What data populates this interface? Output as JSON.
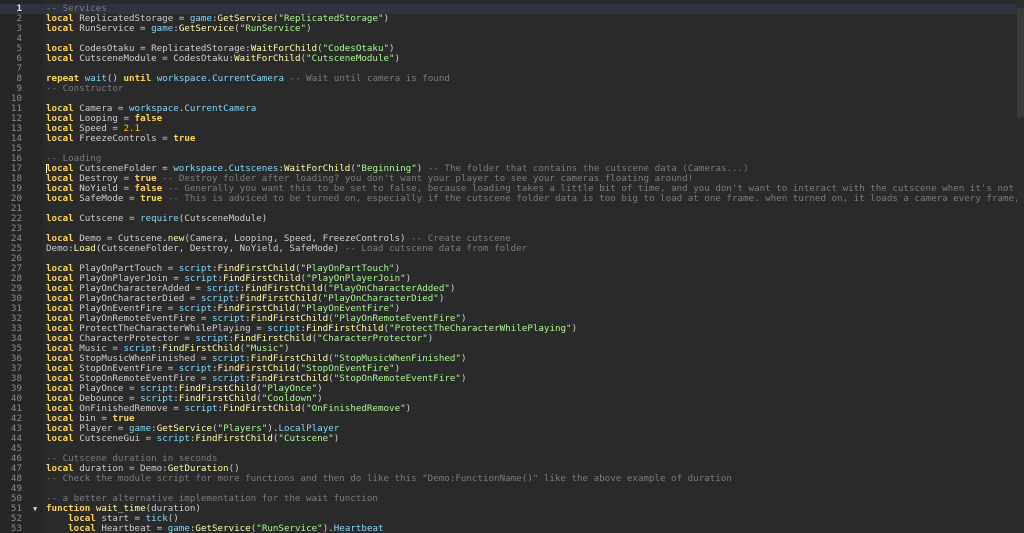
{
  "lines": [
    {
      "n": "1",
      "t": [
        [
          "cm",
          "-- Services"
        ]
      ]
    },
    {
      "n": "2",
      "t": [
        [
          "kw",
          "local"
        ],
        [
          "p",
          " ReplicatedStorage = "
        ],
        [
          "bi",
          "game"
        ],
        [
          "p",
          ":"
        ],
        [
          "fn",
          "GetService"
        ],
        [
          "p",
          "("
        ],
        [
          "str",
          "\"ReplicatedStorage\""
        ],
        [
          "p",
          ")"
        ]
      ]
    },
    {
      "n": "3",
      "t": [
        [
          "kw",
          "local"
        ],
        [
          "p",
          " RunService = "
        ],
        [
          "bi",
          "game"
        ],
        [
          "p",
          ":"
        ],
        [
          "fn",
          "GetService"
        ],
        [
          "p",
          "("
        ],
        [
          "str",
          "\"RunService\""
        ],
        [
          "p",
          ")"
        ]
      ]
    },
    {
      "n": "4",
      "t": []
    },
    {
      "n": "5",
      "t": [
        [
          "kw",
          "local"
        ],
        [
          "p",
          " CodesOtaku = ReplicatedStorage:"
        ],
        [
          "fn",
          "WaitForChild"
        ],
        [
          "p",
          "("
        ],
        [
          "str",
          "\"CodesOtaku\""
        ],
        [
          "p",
          ")"
        ]
      ]
    },
    {
      "n": "6",
      "t": [
        [
          "kw",
          "local"
        ],
        [
          "p",
          " CutsceneModule = CodesOtaku:"
        ],
        [
          "fn",
          "WaitForChild"
        ],
        [
          "p",
          "("
        ],
        [
          "str",
          "\"CutsceneModule\""
        ],
        [
          "p",
          ")"
        ]
      ]
    },
    {
      "n": "7",
      "t": []
    },
    {
      "n": "8",
      "t": [
        [
          "kw",
          "repeat"
        ],
        [
          "p",
          " "
        ],
        [
          "bi",
          "wait"
        ],
        [
          "p",
          "() "
        ],
        [
          "kw",
          "until"
        ],
        [
          "p",
          " "
        ],
        [
          "bi",
          "workspace"
        ],
        [
          "p",
          "."
        ],
        [
          "bi",
          "CurrentCamera"
        ],
        [
          "p",
          " "
        ],
        [
          "cm",
          "-- Wait until camera is found"
        ]
      ]
    },
    {
      "n": "9",
      "t": [
        [
          "cm",
          "-- Constructor"
        ]
      ]
    },
    {
      "n": "10",
      "t": []
    },
    {
      "n": "11",
      "t": [
        [
          "kw",
          "local"
        ],
        [
          "p",
          " Camera = "
        ],
        [
          "bi",
          "workspace"
        ],
        [
          "p",
          "."
        ],
        [
          "bi",
          "CurrentCamera"
        ]
      ]
    },
    {
      "n": "12",
      "t": [
        [
          "kw",
          "local"
        ],
        [
          "p",
          " Looping = "
        ],
        [
          "kw",
          "false"
        ]
      ]
    },
    {
      "n": "13",
      "t": [
        [
          "kw",
          "local"
        ],
        [
          "p",
          " Speed = "
        ],
        [
          "num",
          "2.1"
        ]
      ]
    },
    {
      "n": "14",
      "t": [
        [
          "kw",
          "local"
        ],
        [
          "p",
          " FreezeControls = "
        ],
        [
          "kw",
          "true"
        ]
      ]
    },
    {
      "n": "15",
      "t": []
    },
    {
      "n": "16",
      "t": [
        [
          "cm",
          "-- Loading"
        ]
      ]
    },
    {
      "n": "17",
      "t": [
        [
          "kw",
          "local"
        ],
        [
          "p",
          " CutsceneFolder = "
        ],
        [
          "bi",
          "workspace"
        ],
        [
          "p",
          "."
        ],
        [
          "bi",
          "Cutscenes"
        ],
        [
          "p",
          ":"
        ],
        [
          "fn",
          "WaitForChild"
        ],
        [
          "p",
          "("
        ],
        [
          "str",
          "\"Beginning\""
        ],
        [
          "p",
          ") "
        ],
        [
          "cm",
          "-- The folder that contains the cutscene data (Cameras...)"
        ]
      ]
    },
    {
      "n": "18",
      "t": [
        [
          "kw",
          "local"
        ],
        [
          "p",
          " Destroy = "
        ],
        [
          "kw",
          "true"
        ],
        [
          "p",
          " "
        ],
        [
          "cm",
          "-- Destroy folder after loading? you don't want your player to see your cameras floating around!"
        ]
      ]
    },
    {
      "n": "19",
      "t": [
        [
          "kw",
          "local"
        ],
        [
          "p",
          " NoYield = "
        ],
        [
          "kw",
          "false"
        ],
        [
          "p",
          " "
        ],
        [
          "cm",
          "-- Generally you want this to be set to false, because loading takes a little bit of time, and you don't want to interact with the cutscene when it's not loade"
        ]
      ]
    },
    {
      "n": "20",
      "t": [
        [
          "kw",
          "local"
        ],
        [
          "p",
          " SafeMode = "
        ],
        [
          "kw",
          "true"
        ],
        [
          "p",
          " "
        ],
        [
          "cm",
          "-- This is adviced to be turned on, especially if the cutscene folder data is too big to load at one frame. when turned on, it loads a camera every frame, not"
        ]
      ]
    },
    {
      "n": "21",
      "t": []
    },
    {
      "n": "22",
      "t": [
        [
          "kw",
          "local"
        ],
        [
          "p",
          " Cutscene = "
        ],
        [
          "bi",
          "require"
        ],
        [
          "p",
          "(CutsceneModule)"
        ]
      ]
    },
    {
      "n": "23",
      "t": []
    },
    {
      "n": "24",
      "t": [
        [
          "kw",
          "local"
        ],
        [
          "p",
          " Demo = Cutscene."
        ],
        [
          "fn",
          "new"
        ],
        [
          "p",
          "(Camera, Looping, Speed, FreezeControls) "
        ],
        [
          "cm",
          "-- Create cutscene"
        ]
      ]
    },
    {
      "n": "25",
      "t": [
        [
          "p",
          "Demo:"
        ],
        [
          "fn",
          "Load"
        ],
        [
          "p",
          "(CutsceneFolder, Destroy, NoYield, SafeMode) "
        ],
        [
          "cm",
          "-- Load cutscene data from folder"
        ]
      ]
    },
    {
      "n": "26",
      "t": []
    },
    {
      "n": "27",
      "t": [
        [
          "kw",
          "local"
        ],
        [
          "p",
          " PlayOnPartTouch = "
        ],
        [
          "bi",
          "script"
        ],
        [
          "p",
          ":"
        ],
        [
          "fn",
          "FindFirstChild"
        ],
        [
          "p",
          "("
        ],
        [
          "str",
          "\"PlayOnPartTouch\""
        ],
        [
          "p",
          ")"
        ]
      ]
    },
    {
      "n": "28",
      "t": [
        [
          "kw",
          "local"
        ],
        [
          "p",
          " PlayOnPlayerJoin = "
        ],
        [
          "bi",
          "script"
        ],
        [
          "p",
          ":"
        ],
        [
          "fn",
          "FindFirstChild"
        ],
        [
          "p",
          "("
        ],
        [
          "str",
          "\"PlayOnPlayerJoin\""
        ],
        [
          "p",
          ")"
        ]
      ]
    },
    {
      "n": "29",
      "t": [
        [
          "kw",
          "local"
        ],
        [
          "p",
          " PlayOnCharacterAdded = "
        ],
        [
          "bi",
          "script"
        ],
        [
          "p",
          ":"
        ],
        [
          "fn",
          "FindFirstChild"
        ],
        [
          "p",
          "("
        ],
        [
          "str",
          "\"PlayOnCharacterAdded\""
        ],
        [
          "p",
          ")"
        ]
      ]
    },
    {
      "n": "30",
      "t": [
        [
          "kw",
          "local"
        ],
        [
          "p",
          " PlayOnCharacterDied = "
        ],
        [
          "bi",
          "script"
        ],
        [
          "p",
          ":"
        ],
        [
          "fn",
          "FindFirstChild"
        ],
        [
          "p",
          "("
        ],
        [
          "str",
          "\"PlayOnCharacterDied\""
        ],
        [
          "p",
          ")"
        ]
      ]
    },
    {
      "n": "31",
      "t": [
        [
          "kw",
          "local"
        ],
        [
          "p",
          " PlayOnEventFire = "
        ],
        [
          "bi",
          "script"
        ],
        [
          "p",
          ":"
        ],
        [
          "fn",
          "FindFirstChild"
        ],
        [
          "p",
          "("
        ],
        [
          "str",
          "\"PlayOnEventFire\""
        ],
        [
          "p",
          ")"
        ]
      ]
    },
    {
      "n": "32",
      "t": [
        [
          "kw",
          "local"
        ],
        [
          "p",
          " PlayOnRemoteEventFire = "
        ],
        [
          "bi",
          "script"
        ],
        [
          "p",
          ":"
        ],
        [
          "fn",
          "FindFirstChild"
        ],
        [
          "p",
          "("
        ],
        [
          "str",
          "\"PlayOnRemoteEventFire\""
        ],
        [
          "p",
          ")"
        ]
      ]
    },
    {
      "n": "33",
      "t": [
        [
          "kw",
          "local"
        ],
        [
          "p",
          " ProtectTheCharacterWhilePlaying = "
        ],
        [
          "bi",
          "script"
        ],
        [
          "p",
          ":"
        ],
        [
          "fn",
          "FindFirstChild"
        ],
        [
          "p",
          "("
        ],
        [
          "str",
          "\"ProtectTheCharacterWhilePlaying\""
        ],
        [
          "p",
          ")"
        ]
      ]
    },
    {
      "n": "34",
      "t": [
        [
          "kw",
          "local"
        ],
        [
          "p",
          " CharacterProtector = "
        ],
        [
          "bi",
          "script"
        ],
        [
          "p",
          ":"
        ],
        [
          "fn",
          "FindFirstChild"
        ],
        [
          "p",
          "("
        ],
        [
          "str",
          "\"CharacterProtector\""
        ],
        [
          "p",
          ")"
        ]
      ]
    },
    {
      "n": "35",
      "t": [
        [
          "kw",
          "local"
        ],
        [
          "p",
          " Music = "
        ],
        [
          "bi",
          "script"
        ],
        [
          "p",
          ":"
        ],
        [
          "fn",
          "FindFirstChild"
        ],
        [
          "p",
          "("
        ],
        [
          "str",
          "\"Music\""
        ],
        [
          "p",
          ")"
        ]
      ]
    },
    {
      "n": "36",
      "t": [
        [
          "kw",
          "local"
        ],
        [
          "p",
          " StopMusicWhenFinished = "
        ],
        [
          "bi",
          "script"
        ],
        [
          "p",
          ":"
        ],
        [
          "fn",
          "FindFirstChild"
        ],
        [
          "p",
          "("
        ],
        [
          "str",
          "\"StopMusicWhenFinished\""
        ],
        [
          "p",
          ")"
        ]
      ]
    },
    {
      "n": "37",
      "t": [
        [
          "kw",
          "local"
        ],
        [
          "p",
          " StopOnEventFire = "
        ],
        [
          "bi",
          "script"
        ],
        [
          "p",
          ":"
        ],
        [
          "fn",
          "FindFirstChild"
        ],
        [
          "p",
          "("
        ],
        [
          "str",
          "\"StopOnEventFire\""
        ],
        [
          "p",
          ")"
        ]
      ]
    },
    {
      "n": "38",
      "t": [
        [
          "kw",
          "local"
        ],
        [
          "p",
          " StopOnRemoteEventFire = "
        ],
        [
          "bi",
          "script"
        ],
        [
          "p",
          ":"
        ],
        [
          "fn",
          "FindFirstChild"
        ],
        [
          "p",
          "("
        ],
        [
          "str",
          "\"StopOnRemoteEventFire\""
        ],
        [
          "p",
          ")"
        ]
      ]
    },
    {
      "n": "39",
      "t": [
        [
          "kw",
          "local"
        ],
        [
          "p",
          " PlayOnce = "
        ],
        [
          "bi",
          "script"
        ],
        [
          "p",
          ":"
        ],
        [
          "fn",
          "FindFirstChild"
        ],
        [
          "p",
          "("
        ],
        [
          "str",
          "\"PlayOnce\""
        ],
        [
          "p",
          ")"
        ]
      ]
    },
    {
      "n": "40",
      "t": [
        [
          "kw",
          "local"
        ],
        [
          "p",
          " Debounce = "
        ],
        [
          "bi",
          "script"
        ],
        [
          "p",
          ":"
        ],
        [
          "fn",
          "FindFirstChild"
        ],
        [
          "p",
          "("
        ],
        [
          "str",
          "\"Cooldown\""
        ],
        [
          "p",
          ")"
        ]
      ]
    },
    {
      "n": "41",
      "t": [
        [
          "kw",
          "local"
        ],
        [
          "p",
          " OnFinishedRemove = "
        ],
        [
          "bi",
          "script"
        ],
        [
          "p",
          ":"
        ],
        [
          "fn",
          "FindFirstChild"
        ],
        [
          "p",
          "("
        ],
        [
          "str",
          "\"OnFinishedRemove\""
        ],
        [
          "p",
          ")"
        ]
      ]
    },
    {
      "n": "42",
      "t": [
        [
          "kw",
          "local"
        ],
        [
          "p",
          " bin = "
        ],
        [
          "kw",
          "true"
        ]
      ]
    },
    {
      "n": "43",
      "t": [
        [
          "kw",
          "local"
        ],
        [
          "p",
          " Player = "
        ],
        [
          "bi",
          "game"
        ],
        [
          "p",
          ":"
        ],
        [
          "fn",
          "GetService"
        ],
        [
          "p",
          "("
        ],
        [
          "str",
          "\"Players\""
        ],
        [
          "p",
          ")."
        ],
        [
          "bi",
          "LocalPlayer"
        ]
      ]
    },
    {
      "n": "44",
      "t": [
        [
          "kw",
          "local"
        ],
        [
          "p",
          " CutsceneGui = "
        ],
        [
          "bi",
          "script"
        ],
        [
          "p",
          ":"
        ],
        [
          "fn",
          "FindFirstChild"
        ],
        [
          "p",
          "("
        ],
        [
          "str",
          "\"Cutscene\""
        ],
        [
          "p",
          ")"
        ]
      ]
    },
    {
      "n": "45",
      "t": []
    },
    {
      "n": "46",
      "t": [
        [
          "cm",
          "-- Cutscene duration in seconds"
        ]
      ]
    },
    {
      "n": "47",
      "t": [
        [
          "kw",
          "local"
        ],
        [
          "p",
          " duration = Demo:"
        ],
        [
          "fn",
          "GetDuration"
        ],
        [
          "p",
          "()"
        ]
      ]
    },
    {
      "n": "48",
      "t": [
        [
          "cm",
          "-- Check the module script for more functions and then do like this \"Demo:FunctionName()\" like the above example of duration"
        ]
      ]
    },
    {
      "n": "49",
      "t": []
    },
    {
      "n": "50",
      "t": [
        [
          "cm",
          "-- a better alternative implementation for the wait function"
        ]
      ]
    },
    {
      "n": "51",
      "t": [
        [
          "kw",
          "function"
        ],
        [
          "p",
          " "
        ],
        [
          "fn",
          "wait_time"
        ],
        [
          "p",
          "(duration)"
        ]
      ]
    },
    {
      "n": "52",
      "t": [
        [
          "p",
          "    "
        ],
        [
          "kw",
          "local"
        ],
        [
          "p",
          " start = "
        ],
        [
          "bi",
          "tick"
        ],
        [
          "p",
          "()"
        ]
      ]
    },
    {
      "n": "53",
      "t": [
        [
          "p",
          "    "
        ],
        [
          "kw",
          "local"
        ],
        [
          "p",
          " Heartbeat = "
        ],
        [
          "bi",
          "game"
        ],
        [
          "p",
          ":"
        ],
        [
          "fn",
          "GetService"
        ],
        [
          "p",
          "("
        ],
        [
          "str",
          "\"RunService\""
        ],
        [
          "p",
          ")."
        ],
        [
          "bi",
          "Heartbeat"
        ]
      ]
    }
  ],
  "active_line": "1",
  "cursor_line": "17",
  "fold_line": "51",
  "fold_icon": "chevron-down-icon",
  "colors": {
    "background": "#2a2a2a",
    "keyword": "#f8d55a",
    "string": "#adf195",
    "comment": "#7a7a7a",
    "number": "#ffc600",
    "builtin": "#84d6f7",
    "method": "#fdfbac",
    "text": "#cccccc"
  }
}
